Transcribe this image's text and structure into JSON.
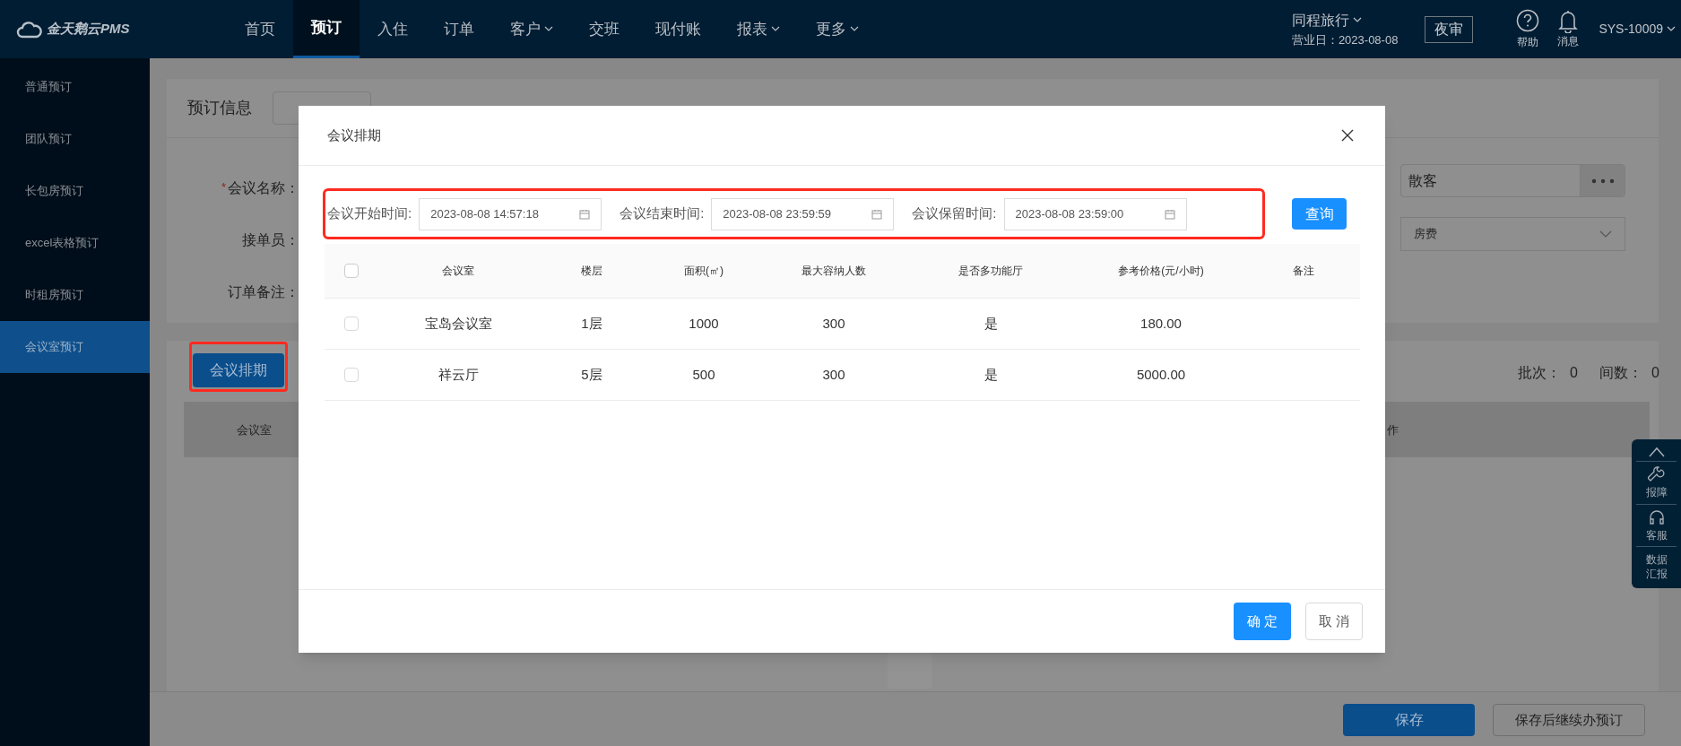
{
  "header": {
    "logo": "金天鹅云PMS",
    "nav": [
      {
        "label": "首页",
        "selected": false,
        "dropdown": false
      },
      {
        "label": "预订",
        "selected": true,
        "dropdown": false
      },
      {
        "label": "入住",
        "selected": false,
        "dropdown": false
      },
      {
        "label": "订单",
        "selected": false,
        "dropdown": false
      },
      {
        "label": "客户",
        "selected": false,
        "dropdown": true
      },
      {
        "label": "交班",
        "selected": false,
        "dropdown": false
      },
      {
        "label": "现付账",
        "selected": false,
        "dropdown": false
      },
      {
        "label": "报表",
        "selected": false,
        "dropdown": true
      },
      {
        "label": "更多",
        "selected": false,
        "dropdown": true
      }
    ],
    "hotel": "同程旅行",
    "business_day": "营业日：2023-08-08",
    "night_audit": "夜审",
    "help": "帮助",
    "messages": "消息",
    "user": "SYS-10009"
  },
  "sidebar": {
    "items": [
      {
        "label": "普通预订",
        "selected": false
      },
      {
        "label": "团队预订",
        "selected": false
      },
      {
        "label": "长包房预订",
        "selected": false
      },
      {
        "label": "excel表格预订",
        "selected": false
      },
      {
        "label": "时租房预订",
        "selected": false
      },
      {
        "label": "会议室预订",
        "selected": true
      }
    ]
  },
  "booking_info": {
    "title": "预订信息",
    "labels": [
      {
        "mark": "*",
        "text": "会议名称："
      },
      {
        "text": "接单员："
      },
      {
        "text": "订单备注："
      }
    ],
    "customer_type": "散客",
    "charge_type": "房费"
  },
  "schedule_panel": {
    "button": "会议排期",
    "batches_label": "批次：",
    "batches": "0",
    "rooms_label": "间数：",
    "rooms": "0",
    "columns": [
      "会议室",
      "作"
    ]
  },
  "side_tools": [
    {
      "kind": "up"
    },
    {
      "kind": "wrench",
      "label": "报障"
    },
    {
      "kind": "headset",
      "label": "客服"
    },
    {
      "kind": "text",
      "label": "数据汇报"
    }
  ],
  "footer": {
    "save": "保存",
    "save_continue": "保存后继续办预订"
  },
  "dialog": {
    "title": "会议排期",
    "filters": [
      {
        "label": "会议开始时间:",
        "value": "2023-08-08 14:57:18"
      },
      {
        "label": "会议结束时间:",
        "value": "2023-08-08 23:59:59"
      },
      {
        "label": "会议保留时间:",
        "value": "2023-08-08 23:59:00"
      }
    ],
    "query": "查询",
    "table": {
      "all_checked": false,
      "columns": [
        "会议室",
        "楼层",
        "面积(㎡)",
        "最大容纳人数",
        "是否多功能厅",
        "参考价格(元/小时)",
        "备注"
      ],
      "rows": [
        {
          "checked": false,
          "cells": [
            "宝岛会议室",
            "1层",
            "1000",
            "300",
            "是",
            "180.00"
          ]
        },
        {
          "checked": false,
          "cells": [
            "祥云厅",
            "5层",
            "500",
            "300",
            "是",
            "5000.00"
          ]
        }
      ]
    },
    "ok": "确 定",
    "cancel": "取 消"
  }
}
